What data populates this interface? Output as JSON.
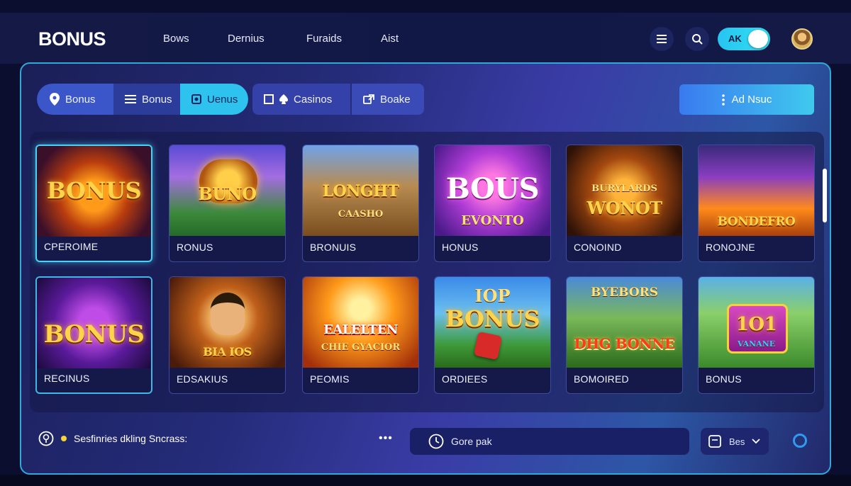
{
  "header": {
    "logo": "BONUS",
    "nav": [
      "Bows",
      "Dernius",
      "Furaids",
      "Aist"
    ],
    "toggle_label": "AK",
    "icons": [
      "menu-icon",
      "search-icon",
      "avatar"
    ]
  },
  "filters": {
    "group1": [
      "Bonus",
      "Bonus",
      "Uenus"
    ],
    "group2": [
      "Casinos",
      "Boake"
    ],
    "cta": "Ad Nsuc"
  },
  "games": [
    {
      "label": "CPEROIME",
      "title": "BONUS",
      "sub": ""
    },
    {
      "label": "RONUS",
      "title": "BUNO",
      "sub": ""
    },
    {
      "label": "BRONUIS",
      "title": "LONGHT",
      "sub": "CAASHO"
    },
    {
      "label": "HONUS",
      "title": "BOUS",
      "sub": "EVONTO"
    },
    {
      "label": "CONOIND",
      "title": "WONOT",
      "sub": "BURYLARDS"
    },
    {
      "label": "RONOJNE",
      "title": "BONDEFRO",
      "sub": ""
    },
    {
      "label": "RECINUS",
      "title": "BONUS",
      "sub": ""
    },
    {
      "label": "EDSAKIUS",
      "title": "BIA IOS",
      "sub": ""
    },
    {
      "label": "PEOMIS",
      "title": "EALELTEN",
      "sub": "CHIE GYACIOR"
    },
    {
      "label": "ORDIEES",
      "title": "BONUS",
      "sub": "IOP"
    },
    {
      "label": "BOMOIRED",
      "title": "DHG BONNE",
      "sub": "BYEBORS"
    },
    {
      "label": "BONUS",
      "title": "1O1",
      "sub": "VANANE"
    }
  ],
  "footer": {
    "status": "Sesfinries dkling Sncrass:",
    "dots": "•••",
    "search_value": "Gore pak",
    "select_value": "Bes"
  },
  "colors": {
    "accent_cyan": "#3fc9ee",
    "accent_blue": "#3a7af0",
    "gold": "#ffd34a"
  }
}
